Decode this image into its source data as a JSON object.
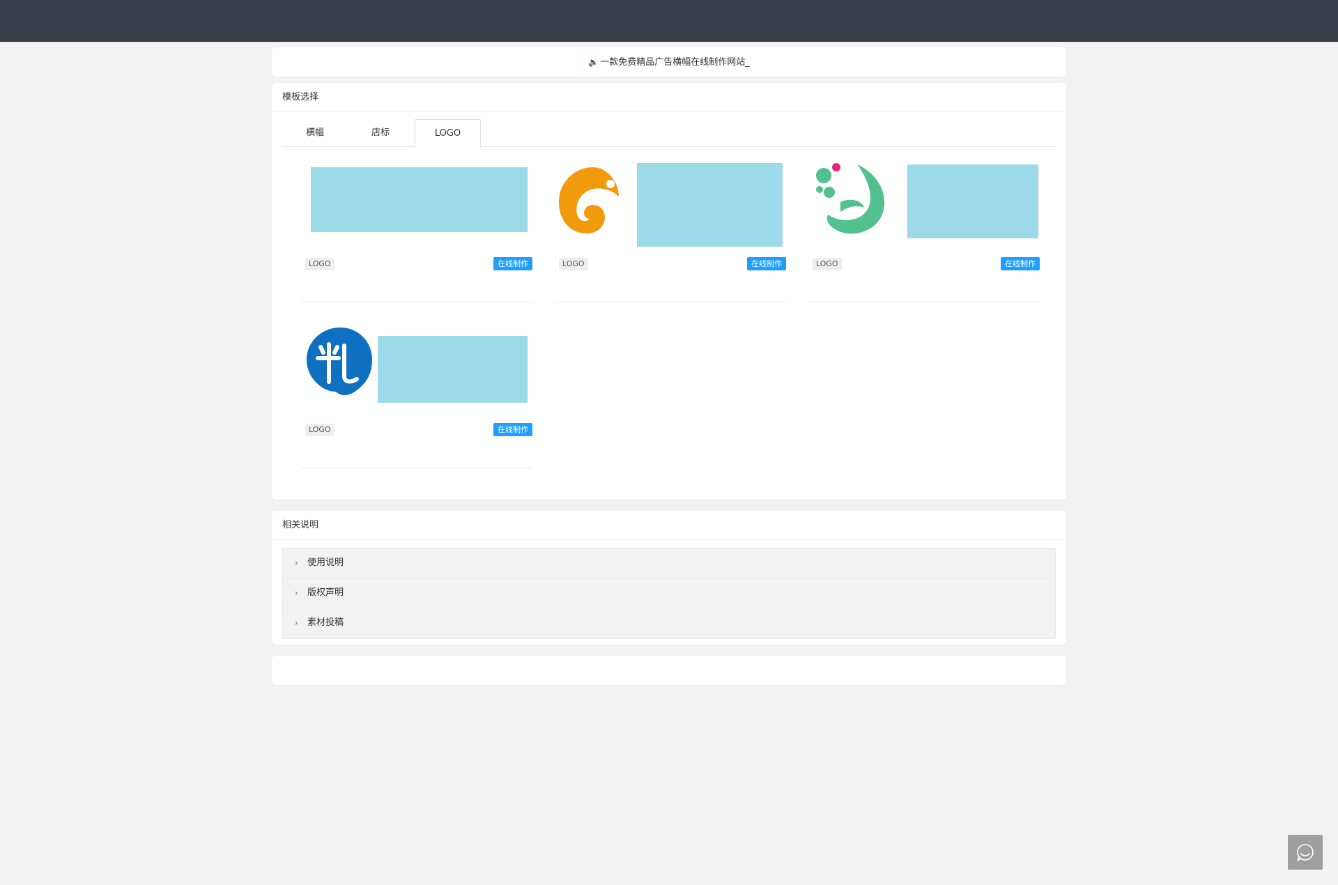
{
  "notice": {
    "icon": "speaker-icon",
    "text": "一款免费精品广告横幅在线制作网站_"
  },
  "templates": {
    "title": "模板选择",
    "tabs": [
      {
        "label": "横幅",
        "active": false
      },
      {
        "label": "店标",
        "active": false
      },
      {
        "label": "LOGO",
        "active": true
      }
    ],
    "items": [
      {
        "tag": "LOGO",
        "action": "在线制作",
        "logo": "placeholder"
      },
      {
        "tag": "LOGO",
        "action": "在线制作",
        "logo": "orange-swirl-logo"
      },
      {
        "tag": "LOGO",
        "action": "在线制作",
        "logo": "green-dots-logo"
      },
      {
        "tag": "LOGO",
        "action": "在线制作",
        "logo": "blue-rice-logo"
      }
    ]
  },
  "info": {
    "title": "相关说明",
    "items": [
      {
        "label": "使用说明"
      },
      {
        "label": "版权声明"
      },
      {
        "label": "素材投稿"
      }
    ]
  },
  "colors": {
    "topbar": "#393d49",
    "accent": "#1e9fff",
    "redacted": "#9cd9e9",
    "orange_logo": "#f29a0e",
    "green_logo": "#52c18e",
    "blue_logo": "#0f6fc0"
  },
  "float_button": {
    "icon": "chat-icon"
  }
}
